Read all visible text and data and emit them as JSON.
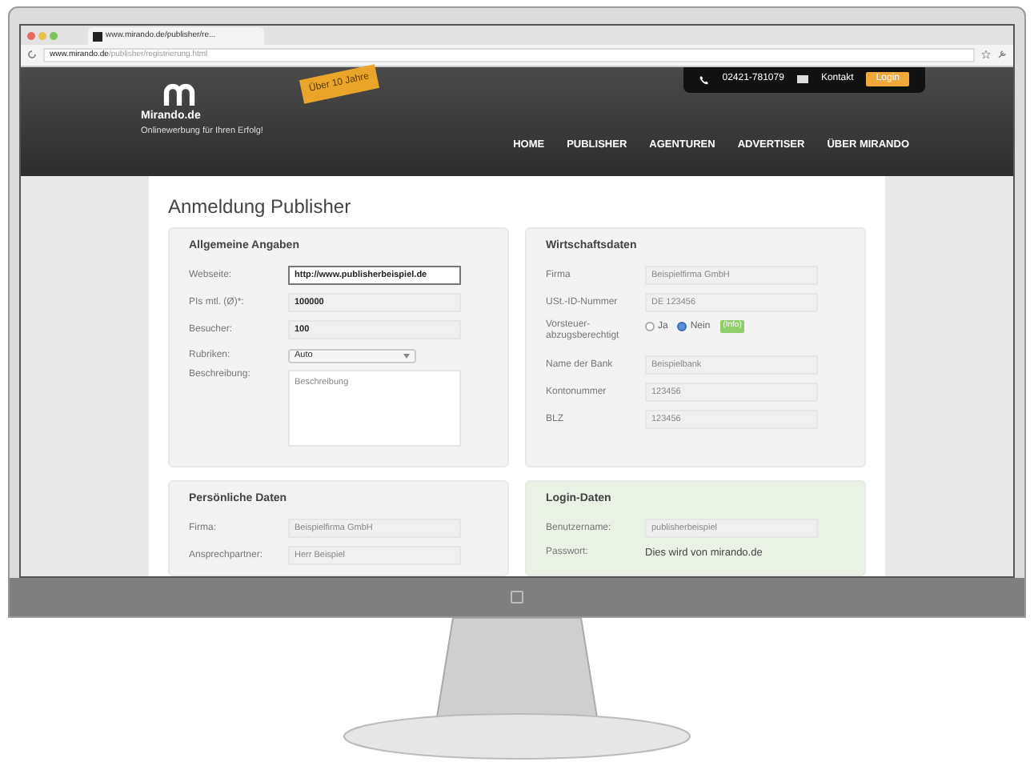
{
  "browser": {
    "tab_title": "www.mirando.de/publisher/re...",
    "url_host": "www.mirando.de",
    "url_path": "/publisher/registrierung.html"
  },
  "header": {
    "brand": "Mirando.de",
    "tagline": "Onlinewerbung für Ihren Erfolg!",
    "badge": "Über 10 Jahre",
    "phone": "02421-781079",
    "contact": "Kontakt",
    "login": "Login",
    "nav": [
      "HOME",
      "PUBLISHER",
      "AGENTUREN",
      "ADVERTISER",
      "ÜBER MIRANDO"
    ]
  },
  "page_title": "Anmeldung Publisher",
  "sections": [
    {
      "title": "Allgemeine Angaben",
      "color": "#f3f3f3",
      "fields": [
        {
          "kind": "input",
          "label": "Webseite:",
          "value": "http://www.publisherbeispiel.de",
          "focused": true
        },
        {
          "kind": "input",
          "label": "PIs mtl. (Ø)*:",
          "value": "100000",
          "focused": false
        },
        {
          "kind": "input",
          "label": "Besucher:",
          "value": "100",
          "focused": false
        },
        {
          "kind": "select",
          "label": "Rubriken:",
          "value": "Auto"
        },
        {
          "kind": "textarea",
          "label": "Beschreibung:",
          "placeholder": "Beschreibung"
        }
      ]
    },
    {
      "title": "Wirtschaftsdaten",
      "color": "#f3f3f3",
      "fields": [
        {
          "kind": "input",
          "label": "Firma",
          "placeholder": "Beispielfirma GmbH"
        },
        {
          "kind": "input",
          "label": "USt.-ID-Nummer",
          "placeholder": "DE 123456"
        },
        {
          "kind": "radio",
          "label": "Vorsteuer-abzugsberechtigt",
          "options": [
            {
              "label": "Ja",
              "selected": false
            },
            {
              "label": "Nein",
              "selected": true
            }
          ],
          "info": "(Info)"
        },
        {
          "kind": "input",
          "label": "Name der Bank",
          "placeholder": "Beispielbank"
        },
        {
          "kind": "input",
          "label": "Kontonummer",
          "placeholder": "123456"
        },
        {
          "kind": "input",
          "label": "BLZ",
          "placeholder": "123456"
        }
      ]
    },
    {
      "title": "Persönliche Daten",
      "color": "#f3f3f3",
      "fields": [
        {
          "kind": "input",
          "label": "Firma:",
          "placeholder": "Beispielfirma GmbH"
        },
        {
          "kind": "input",
          "label": "Ansprechpartner:",
          "placeholder": "Herr Beispiel"
        }
      ]
    },
    {
      "title": "Login-Daten",
      "color": "#eaf2e6",
      "fields": [
        {
          "kind": "input",
          "label": "Benutzername:",
          "placeholder": "publisherbeispiel"
        },
        {
          "kind": "note",
          "label": "Passwort:",
          "value": "Dies wird von mirando.de"
        }
      ]
    }
  ]
}
